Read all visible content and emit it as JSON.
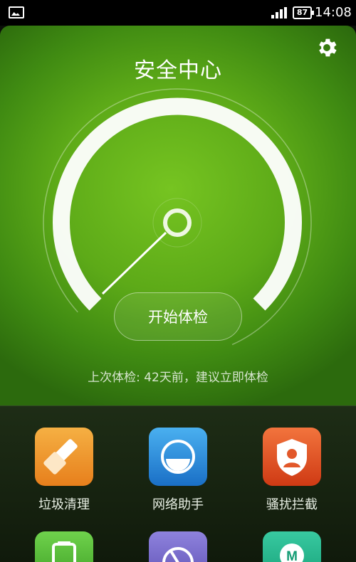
{
  "status_bar": {
    "battery": "87",
    "time": "14:08",
    "icons": [
      "image-notification-icon",
      "signal-icon",
      "battery-icon"
    ]
  },
  "header": {
    "title": "安全中心",
    "settings_icon": "gear-icon"
  },
  "gauge": {
    "needle_level": 0.0
  },
  "scan": {
    "button_label": "开始体检",
    "last_check_text": "上次体检: 42天前，建议立即体检"
  },
  "tools": [
    {
      "label": "垃圾清理",
      "icon": "broom-icon",
      "color": "#F0992E"
    },
    {
      "label": "网络助手",
      "icon": "network-gauge-icon",
      "color": "#2E8EDB"
    },
    {
      "label": "骚扰拦截",
      "icon": "shield-user-icon",
      "color": "#E2582A"
    },
    {
      "label": "",
      "icon": "battery-icon",
      "color": "#4FB834"
    },
    {
      "label": "",
      "icon": "power-icon",
      "color": "#7468C8"
    },
    {
      "label": "",
      "icon": "m-badge-icon",
      "color": "#25B187"
    }
  ],
  "colors": {
    "accent_green": "#6BBE1F",
    "status_bar": "#000000"
  }
}
